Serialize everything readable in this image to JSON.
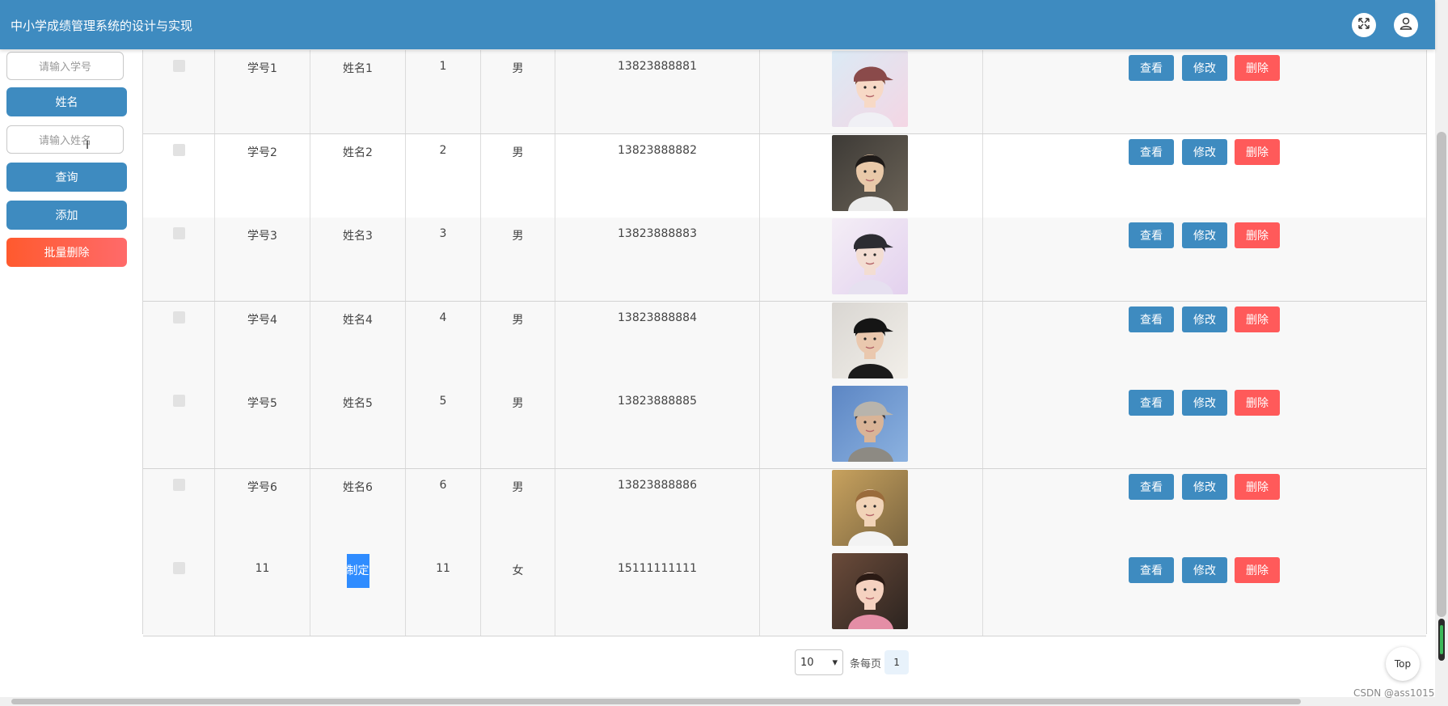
{
  "header": {
    "title": "中小学成绩管理系统的设计与实现",
    "color": "#3e8bc0",
    "icons": [
      "expand-icon",
      "user-icon"
    ]
  },
  "sidebar": {
    "student_no_placeholder": "请输入学号",
    "name_label": "姓名",
    "name_placeholder": "请输入姓名",
    "query_label": "查询",
    "add_label": "添加",
    "batch_delete_label": "批量删除"
  },
  "table": {
    "actions": {
      "view": "查看",
      "edit": "修改",
      "delete": "删除"
    },
    "rows": [
      {
        "student_no": "学号1",
        "name": "姓名1",
        "class": "1",
        "gender": "男",
        "phone": "13823888881",
        "photo": "girl-with-cap-photo"
      },
      {
        "student_no": "学号2",
        "name": "姓名2",
        "class": "2",
        "gender": "男",
        "phone": "13823888882",
        "photo": "boy-peace-sign-photo"
      },
      {
        "student_no": "学号3",
        "name": "姓名3",
        "class": "3",
        "gender": "男",
        "phone": "13823888883",
        "photo": "girl-with-cap-poster-photo"
      },
      {
        "student_no": "学号4",
        "name": "姓名4",
        "class": "4",
        "gender": "男",
        "phone": "13823888884",
        "photo": "boy-black-cap-photo"
      },
      {
        "student_no": "学号5",
        "name": "姓名5",
        "class": "5",
        "gender": "男",
        "phone": "13823888885",
        "photo": "boy-grey-hoodie-photo"
      },
      {
        "student_no": "学号6",
        "name": "姓名6",
        "class": "6",
        "gender": "男",
        "phone": "13823888886",
        "photo": "boy-white-jacket-photo"
      },
      {
        "student_no": "11",
        "name": "制定",
        "class": "11",
        "gender": "女",
        "phone": "15111111111",
        "photo": "girl-smiling-photo"
      }
    ]
  },
  "pager": {
    "page_size": "10",
    "per_page_label": "条每页",
    "current_page": "1"
  },
  "top_button": "Top",
  "watermark": "CSDN @ass1015",
  "colors": {
    "primary": "#3e8bc0",
    "danger": "#ff5a5a",
    "selected_text": "#2f8cff"
  }
}
